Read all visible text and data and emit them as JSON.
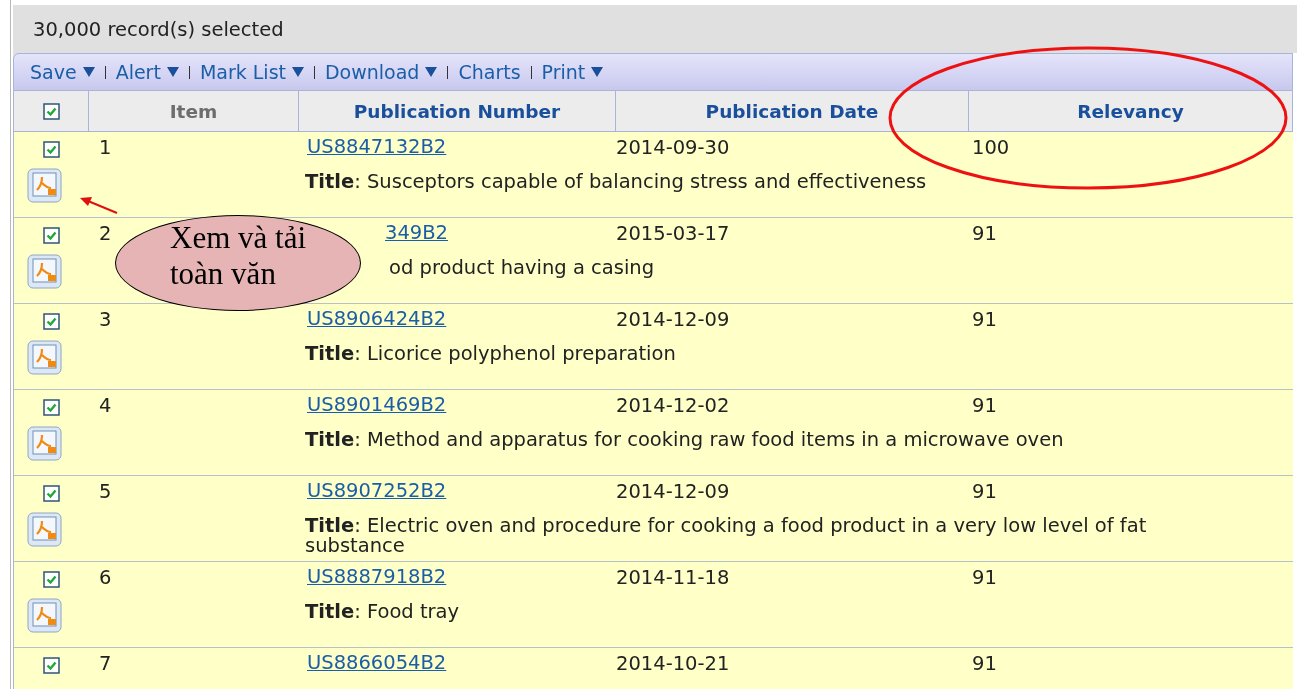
{
  "selection_summary": "30,000 record(s) selected",
  "toolbar": [
    {
      "label": "Save",
      "dropdown": true
    },
    {
      "label": "Alert",
      "dropdown": true
    },
    {
      "label": "Mark List",
      "dropdown": true
    },
    {
      "label": "Download",
      "dropdown": true
    },
    {
      "label": "Charts",
      "dropdown": false
    },
    {
      "label": "Print",
      "dropdown": true
    }
  ],
  "table": {
    "select_all_checked": true,
    "columns": [
      "Item",
      "Publication Number",
      "Publication Date",
      "Relevancy"
    ],
    "rows": [
      {
        "checked": true,
        "item": "1",
        "publication_number": "US8847132B2",
        "publication_date": "2014-09-30",
        "relevancy": "100",
        "title": "**Title**: Susceptors capable of balancing stress and effectiveness",
        "covered": false
      },
      {
        "checked": true,
        "item": "2",
        "publication_number": "349B2",
        "publication_date": "2015-03-17",
        "relevancy": "91",
        "title": "od product having a casing",
        "covered": true
      },
      {
        "checked": true,
        "item": "3",
        "publication_number": "US8906424B2",
        "publication_date": "2014-12-09",
        "relevancy": "91",
        "title": "**Title**: Licorice polyphenol preparation",
        "covered": false
      },
      {
        "checked": true,
        "item": "4",
        "publication_number": "US8901469B2",
        "publication_date": "2014-12-02",
        "relevancy": "91",
        "title": "**Title**: Method and apparatus for cooking raw food items in a microwave oven",
        "covered": false
      },
      {
        "checked": true,
        "item": "5",
        "publication_number": "US8907252B2",
        "publication_date": "2014-12-09",
        "relevancy": "91",
        "title": "**Title**: Electric oven and procedure for cooking a food product in a very low level of fat substance",
        "covered": false
      },
      {
        "checked": true,
        "item": "6",
        "publication_number": "US8887918B2",
        "publication_date": "2014-11-18",
        "relevancy": "91",
        "title": "**Title**: Food tray",
        "covered": false
      },
      {
        "checked": true,
        "item": "7",
        "publication_number": "US8866054B2",
        "publication_date": "2014-10-21",
        "relevancy": "91",
        "covered": false
      }
    ]
  },
  "callout": {
    "text": "Xem và tải toàn văn"
  }
}
